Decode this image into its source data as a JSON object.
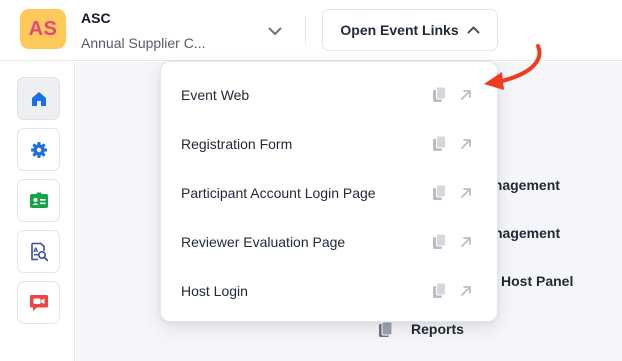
{
  "header": {
    "avatar_initials": "AS",
    "event_code": "ASC",
    "event_name": "Annual Supplier C...",
    "open_links_label": "Open Event Links",
    "icons": {
      "event_switch": "chevron-down-icon",
      "open_links": "chevron-up-icon"
    }
  },
  "colors": {
    "avatar_bg": "#ffc95a",
    "avatar_text": "#e4477f",
    "home": "#1e6fe0",
    "settings": "#1e6fe0",
    "badge": "#16a34a",
    "report": "#3b4ba8",
    "video": "#ef4444",
    "annotation": "#ee3b22"
  },
  "sidebar": {
    "items": [
      {
        "icon": "home-icon",
        "active": true
      },
      {
        "icon": "gear-icon",
        "active": false
      },
      {
        "icon": "id-badge-icon",
        "active": false
      },
      {
        "icon": "document-search-icon",
        "active": false
      },
      {
        "icon": "video-chat-icon",
        "active": false
      }
    ]
  },
  "main": {
    "background_items": [
      {
        "label": "anagement"
      },
      {
        "label": "nagement"
      },
      {
        "label": "Host Panel"
      },
      {
        "label": "Reports",
        "icon": "reports-icon"
      }
    ]
  },
  "dropdown": {
    "items": [
      {
        "label": "Event Web",
        "copy_icon": "copy-icon",
        "open_icon": "external-link-icon"
      },
      {
        "label": "Registration Form",
        "copy_icon": "copy-icon",
        "open_icon": "external-link-icon"
      },
      {
        "label": "Participant Account Login Page",
        "copy_icon": "copy-icon",
        "open_icon": "external-link-icon"
      },
      {
        "label": "Reviewer Evaluation Page",
        "copy_icon": "copy-icon",
        "open_icon": "external-link-icon"
      },
      {
        "label": "Host Login",
        "copy_icon": "copy-icon",
        "open_icon": "external-link-icon"
      }
    ]
  }
}
